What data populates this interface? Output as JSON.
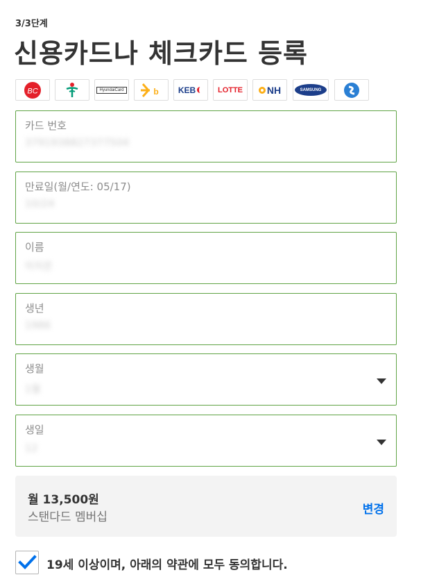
{
  "header": {
    "step": "3/3단계",
    "title": "신용카드나 체크카드 등록"
  },
  "card_logos": [
    {
      "icon": "bc-card-logo",
      "text": "BC"
    },
    {
      "icon": "hana-card-logo",
      "text": ""
    },
    {
      "icon": "hyundai-card-logo",
      "text": "HyundaiCard"
    },
    {
      "icon": "kb-card-logo",
      "text": "KB"
    },
    {
      "icon": "keb-card-logo",
      "text": "KEB"
    },
    {
      "icon": "lotte-card-logo",
      "text": "LOTTE"
    },
    {
      "icon": "nh-card-logo",
      "text": "NH"
    },
    {
      "icon": "samsung-card-logo",
      "text": "SAMSUNG"
    },
    {
      "icon": "shinhan-card-logo",
      "text": ""
    }
  ],
  "form": {
    "card_number": {
      "label": "카드 번호",
      "value": "3791938827377504"
    },
    "expiry": {
      "label": "만료일(월/연도: 05/17)",
      "value": "10/24"
    },
    "name": {
      "label": "이름",
      "value": "이지은"
    },
    "birth_year": {
      "label": "생년",
      "value": "1986"
    },
    "birth_month": {
      "label": "생월",
      "value": "1월"
    },
    "birth_day": {
      "label": "생일",
      "value": "12"
    }
  },
  "plan": {
    "price": "월 13,500원",
    "name": "스탠다드 멤버십",
    "change_label": "변경"
  },
  "agreement": {
    "checked": true,
    "text": "19세 이상이며, 아래의 약관에 모두 동의합니다."
  },
  "colors": {
    "field_border": "#5fa344",
    "link": "#0071eb",
    "check": "#0071eb"
  }
}
